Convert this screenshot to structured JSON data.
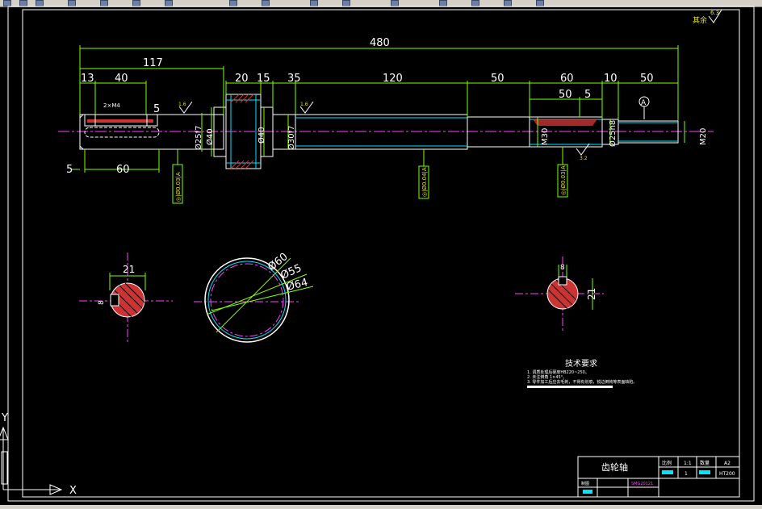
{
  "colors": {
    "background": "#000000",
    "outline": "#ffffff",
    "dimension": "#7dff00",
    "text": "#e6e600",
    "centerline": "#ff40ff",
    "hatch": "#cc3333",
    "cyan": "#00e5ff"
  },
  "roughness_note": "其余",
  "roughness_value": "6.3",
  "dims": {
    "overall": "480",
    "left_section": "117",
    "d13": "13",
    "d40": "40",
    "d5a": "5",
    "d20": "20",
    "d15": "15",
    "d35": "35",
    "d120": "120",
    "d50a": "50",
    "d60a": "60",
    "d10": "10",
    "d50b": "50",
    "d50c": "50",
    "d5b": "5",
    "d5c": "5",
    "d60b": "60",
    "phi25f7": "Ø25f7",
    "phi40a": "Ø40",
    "phi40b": "Ø40",
    "phi30f7": "Ø30f7",
    "m30": "M30",
    "phi25h8": "Ø25h8",
    "m20": "M20",
    "keyway_note": "2×M4",
    "r16a": "1.6",
    "r16b": "1.6",
    "r32": "3.2",
    "datum": "A",
    "tol1": "◎|Ø0.03|A",
    "tol2": "◎|Ø0.04|A",
    "tol3": "◎|Ø0.03|A"
  },
  "sections": {
    "s1_width": "21",
    "s1_depth": "8",
    "gear_d60": "Ø60",
    "gear_d55": "Ø55",
    "gear_d64": "Ø64",
    "s3_width": "8",
    "s3_depth": "21"
  },
  "tech": {
    "title": "技术要求",
    "items": [
      "1. 调质处理后硬度HB220~250。",
      "2. 未注倒角 1×45°。",
      "3. 零件加工后应去毛刺，不得有划痕，锐边倒钝等表面缺陷。"
    ]
  },
  "titleblock": {
    "name": "齿轮轴",
    "h_scale": "比例",
    "v_scale": "1:1",
    "h_qty": "数量",
    "v_qty": "1",
    "h_sheet": "A2",
    "material": "HT200",
    "drawn": "制图",
    "code": "SMG20121"
  },
  "ucs": {
    "x": "X",
    "y": "Y"
  }
}
